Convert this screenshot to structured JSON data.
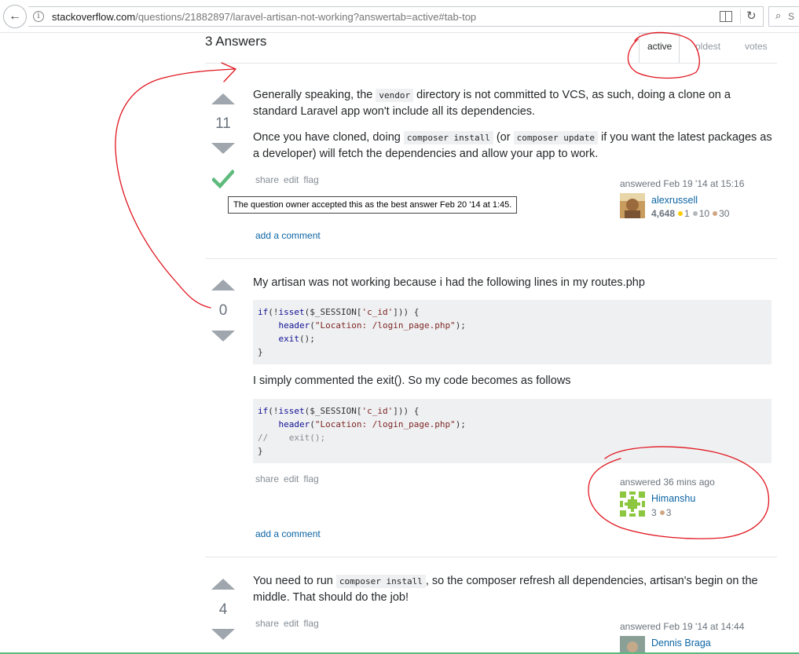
{
  "browser": {
    "url_domain": "stackoverflow.com",
    "url_path": "/questions/21882897/laravel-artisan-not-working?answertab=active#tab-top",
    "search_initial": "S"
  },
  "header": {
    "answers_title": "3 Answers",
    "tabs": [
      "active",
      "oldest",
      "votes"
    ],
    "active_tab": "active"
  },
  "answers": [
    {
      "votes": "11",
      "accepted": true,
      "p1": [
        "Generally speaking, the ",
        "vendor",
        " directory is not committed to VCS, as such, doing a clone on a standard Laravel app won't include all its dependencies."
      ],
      "p2": [
        "Once you have cloned, doing ",
        "composer install",
        " (or ",
        "composer update",
        " if you want the latest packages as a developer) will fetch the dependencies and allow your app to work."
      ],
      "menu": [
        "share",
        "edit",
        "flag"
      ],
      "tooltip": "The question owner accepted this as the best answer Feb 20 '14 at 1:45.",
      "add_comment": "add a comment",
      "answered": "answered Feb 19 '14 at 15:16",
      "user": "alexrussell",
      "rep": "4,648",
      "gold": "1",
      "silver": "10",
      "bronze": "30"
    },
    {
      "votes": "0",
      "p1": "My artisan was not working because i had the following lines in my routes.php",
      "code1": [
        "if(!isset($_SESSION['c_id'])) {",
        "    header(\"Location: /login_page.php\");",
        "    exit();",
        "}"
      ],
      "p2": "I simply commented the exit(). So my code becomes as follows",
      "code2": [
        "if(!isset($_SESSION['c_id'])) {",
        "    header(\"Location: /login_page.php\");",
        "//    exit();",
        "}"
      ],
      "menu": [
        "share",
        "edit",
        "flag"
      ],
      "add_comment": "add a comment",
      "answered": "answered 36 mins ago",
      "user": "Himanshu",
      "rep": "3",
      "bronze": "3"
    },
    {
      "votes": "4",
      "p1": [
        "You need to run ",
        "composer install",
        ", so the composer refresh all dependencies, artisan's begin on the middle. That should do the job!"
      ],
      "menu": [
        "share",
        "edit",
        "flag"
      ],
      "answered": "answered Feb 19 '14 at 14:44",
      "user": "Dennis Braga"
    }
  ],
  "colors": {
    "link": "#0c65a5",
    "accepted": "#5eba7d",
    "annotation": "#e0141e",
    "gold": "#ffcc01",
    "silver": "#b4b8bc",
    "bronze": "#d1a684"
  }
}
